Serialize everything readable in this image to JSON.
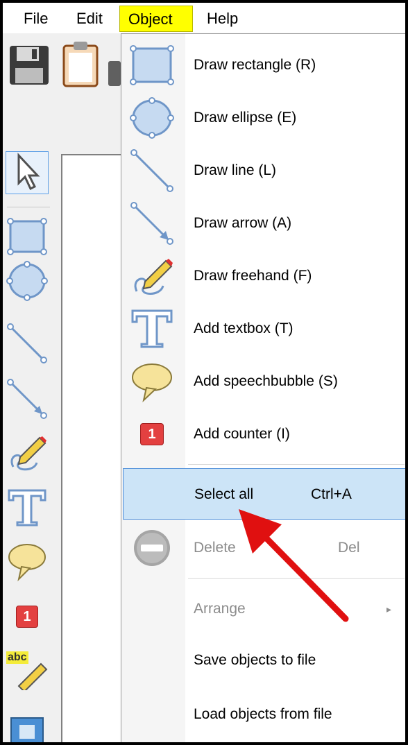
{
  "menubar": {
    "items": [
      {
        "label": "File"
      },
      {
        "label": "Edit"
      },
      {
        "label": "Object"
      },
      {
        "label": "Help"
      }
    ],
    "active_index": 2,
    "highlight_color": "#ffff00"
  },
  "toolbar": {
    "icons": [
      "save-icon",
      "clipboard-icon",
      "printer-icon"
    ]
  },
  "tools": [
    {
      "icon": "select-arrow-icon",
      "selected": true
    },
    {
      "icon": "rectangle-icon"
    },
    {
      "icon": "ellipse-icon"
    },
    {
      "icon": "line-icon"
    },
    {
      "icon": "arrow-tool-icon"
    },
    {
      "icon": "freehand-icon"
    },
    {
      "icon": "textbox-icon"
    },
    {
      "icon": "speechbubble-icon"
    },
    {
      "icon": "counter-icon"
    },
    {
      "icon": "highlight-icon"
    },
    {
      "icon": "obfuscate-icon"
    }
  ],
  "counter_badge": "1",
  "highlight_badge": "abc",
  "dropdown": {
    "items": [
      {
        "label": "Draw rectangle (R)",
        "icon": "rectangle-icon"
      },
      {
        "label": "Draw ellipse (E)",
        "icon": "ellipse-icon"
      },
      {
        "label": "Draw line (L)",
        "icon": "line-icon"
      },
      {
        "label": "Draw arrow (A)",
        "icon": "arrow-tool-icon"
      },
      {
        "label": "Draw freehand (F)",
        "icon": "freehand-icon"
      },
      {
        "label": "Add textbox (T)",
        "icon": "textbox-icon"
      },
      {
        "label": "Add speechbubble (S)",
        "icon": "speechbubble-icon"
      },
      {
        "label": "Add counter (I)",
        "icon": "counter-icon"
      },
      {
        "label": "Select all",
        "shortcut": "Ctrl+A",
        "highlighted": true
      },
      {
        "label": "Delete",
        "shortcut": "Del",
        "icon": "delete-icon",
        "disabled": true
      },
      {
        "label": "Arrange",
        "disabled": true,
        "submenu": true
      },
      {
        "label": "Save objects to file"
      },
      {
        "label": "Load objects from file"
      }
    ],
    "highlight_color": "#cce4f7"
  },
  "annotation": {
    "icon": "red-arrow-icon",
    "color": "#e01010"
  }
}
